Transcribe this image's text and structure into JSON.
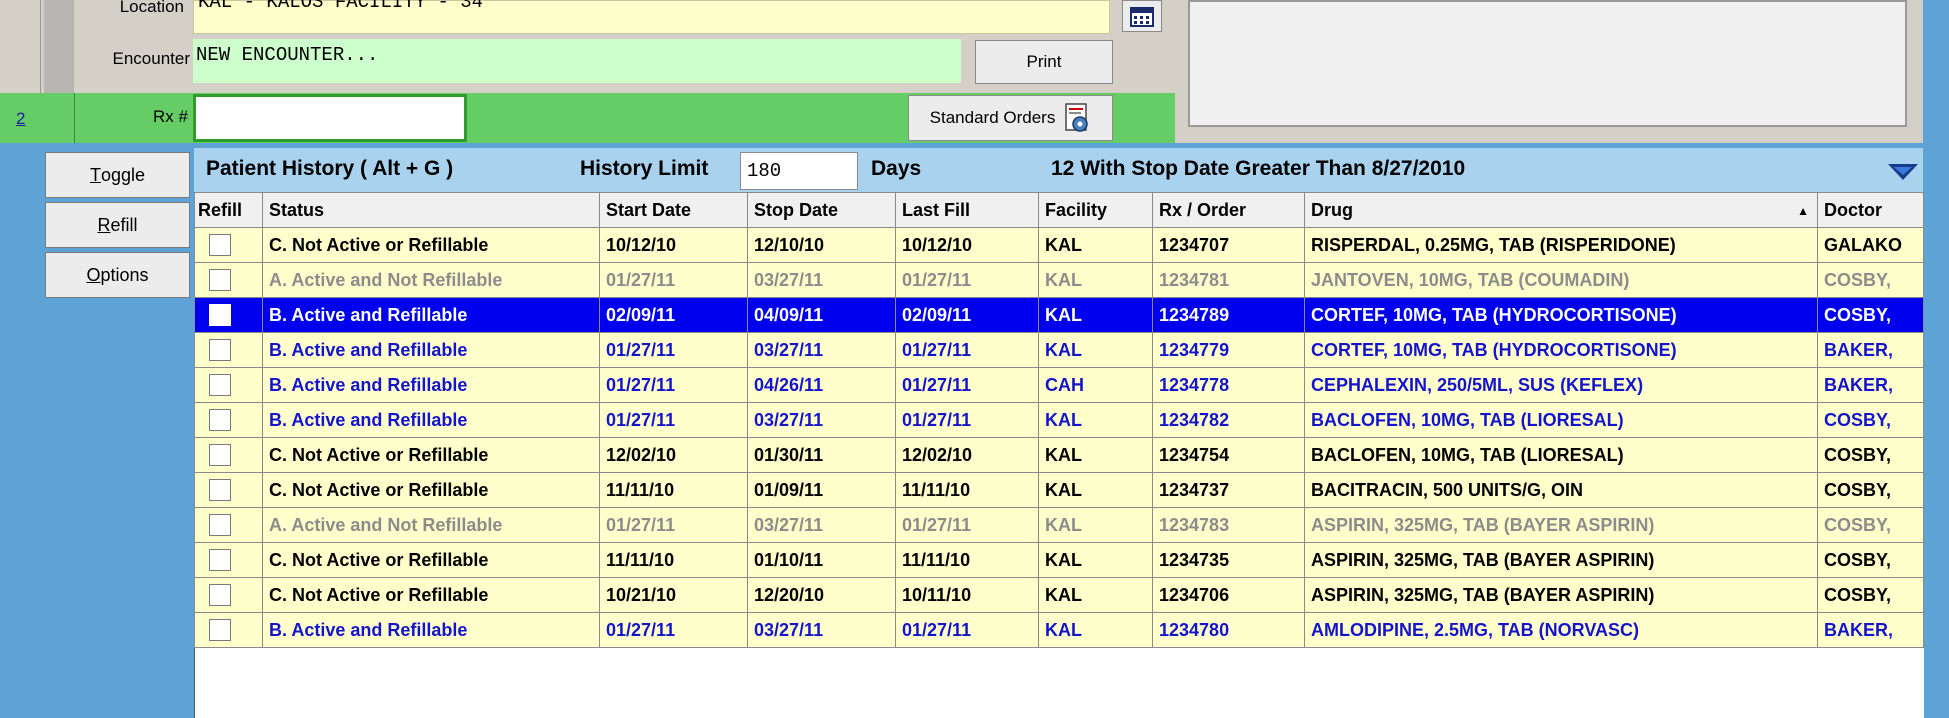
{
  "form": {
    "location_label": "Location",
    "location_value": "KAL - KALOS FACILITY - 34",
    "encounter_label": "Encounter",
    "encounter_value": "NEW ENCOUNTER...",
    "print_label": "Print",
    "rx_row_number": "2",
    "rx_label": "Rx #",
    "rx_value": "",
    "standard_orders_label": "Standard Orders"
  },
  "sidebar": {
    "toggle_label": "Toggle",
    "toggle_mnemonic": "T",
    "refill_label": "Refill",
    "refill_mnemonic": "R",
    "options_label": "Options",
    "options_mnemonic": "O"
  },
  "history": {
    "title": "Patient History ( Alt + G )",
    "limit_label": "History Limit",
    "limit_value": "180",
    "days_label": "Days",
    "summary": "12 With Stop Date Greater Than 8/27/2010"
  },
  "table": {
    "columns": [
      "Refill",
      "Status",
      "Start Date",
      "Stop Date",
      "Last Fill",
      "Facility",
      "Rx / Order",
      "Drug",
      "Doctor"
    ],
    "rows": [
      {
        "style": "black",
        "status": "C. Not Active or Refillable",
        "start": "10/12/10",
        "stop": "12/10/10",
        "last": "10/12/10",
        "facility": "KAL",
        "rx": "1234707",
        "drug": "RISPERDAL, 0.25MG, TAB (RISPERIDONE)",
        "doctor": "GALAKO"
      },
      {
        "style": "grey",
        "status": "A. Active and Not Refillable",
        "start": "01/27/11",
        "stop": "03/27/11",
        "last": "01/27/11",
        "facility": "KAL",
        "rx": "1234781",
        "drug": "JANTOVEN, 10MG, TAB (COUMADIN)",
        "doctor": "COSBY,"
      },
      {
        "style": "sel",
        "status": "B. Active and Refillable",
        "start": "02/09/11",
        "stop": "04/09/11",
        "last": "02/09/11",
        "facility": "KAL",
        "rx": "1234789",
        "drug": "CORTEF, 10MG, TAB (HYDROCORTISONE)",
        "doctor": "COSBY,"
      },
      {
        "style": "blue",
        "status": "B. Active and Refillable",
        "start": "01/27/11",
        "stop": "03/27/11",
        "last": "01/27/11",
        "facility": "KAL",
        "rx": "1234779",
        "drug": "CORTEF, 10MG, TAB (HYDROCORTISONE)",
        "doctor": "BAKER,"
      },
      {
        "style": "blue",
        "status": "B. Active and Refillable",
        "start": "01/27/11",
        "stop": "04/26/11",
        "last": "01/27/11",
        "facility": "CAH",
        "rx": "1234778",
        "drug": "CEPHALEXIN, 250/5ML, SUS (KEFLEX)",
        "doctor": "BAKER,"
      },
      {
        "style": "blue",
        "status": "B. Active and Refillable",
        "start": "01/27/11",
        "stop": "03/27/11",
        "last": "01/27/11",
        "facility": "KAL",
        "rx": "1234782",
        "drug": "BACLOFEN, 10MG, TAB (LIORESAL)",
        "doctor": "COSBY,"
      },
      {
        "style": "black",
        "status": "C. Not Active or Refillable",
        "start": "12/02/10",
        "stop": "01/30/11",
        "last": "12/02/10",
        "facility": "KAL",
        "rx": "1234754",
        "drug": "BACLOFEN, 10MG, TAB (LIORESAL)",
        "doctor": "COSBY,"
      },
      {
        "style": "black",
        "status": "C. Not Active or Refillable",
        "start": "11/11/10",
        "stop": "01/09/11",
        "last": "11/11/10",
        "facility": "KAL",
        "rx": "1234737",
        "drug": "BACITRACIN, 500 UNITS/G, OIN",
        "doctor": "COSBY,"
      },
      {
        "style": "grey",
        "status": "A. Active and Not Refillable",
        "start": "01/27/11",
        "stop": "03/27/11",
        "last": "01/27/11",
        "facility": "KAL",
        "rx": "1234783",
        "drug": "ASPIRIN, 325MG, TAB (BAYER ASPIRIN)",
        "doctor": "COSBY,"
      },
      {
        "style": "black",
        "status": "C. Not Active or Refillable",
        "start": "11/11/10",
        "stop": "01/10/11",
        "last": "11/11/10",
        "facility": "KAL",
        "rx": "1234735",
        "drug": "ASPIRIN, 325MG, TAB (BAYER ASPIRIN)",
        "doctor": "COSBY,"
      },
      {
        "style": "black",
        "status": "C. Not Active or Refillable",
        "start": "10/21/10",
        "stop": "12/20/10",
        "last": "10/11/10",
        "facility": "KAL",
        "rx": "1234706",
        "drug": "ASPIRIN, 325MG, TAB (BAYER ASPIRIN)",
        "doctor": "COSBY,"
      },
      {
        "style": "blue",
        "status": "B. Active and Refillable",
        "start": "01/27/11",
        "stop": "03/27/11",
        "last": "01/27/11",
        "facility": "KAL",
        "rx": "1234780",
        "drug": "AMLODIPINE, 2.5MG, TAB (NORVASC)",
        "doctor": "BAKER,"
      }
    ]
  },
  "colors": {
    "frame_blue": "#5da3d6",
    "selected_row": "#0000ee",
    "row_background": "#ffffcc",
    "active_text_blue": "#1414cc",
    "inactive_text_grey": "#8c8c8c",
    "rx_row_green": "#66cc66",
    "encounter_green": "#ccffcc"
  },
  "icons": {
    "calendar": "calendar-icon",
    "standard_orders": "gear-document-icon",
    "collapse": "triangle-down-icon"
  }
}
